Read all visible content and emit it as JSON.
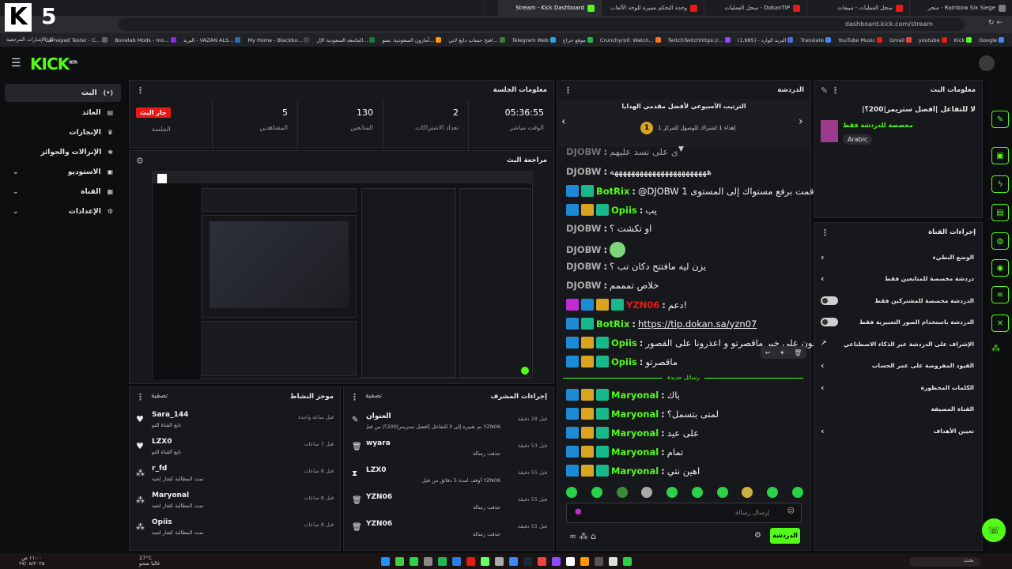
{
  "browser": {
    "tabs": [
      {
        "title": "Rainbow Six Siege - متجر",
        "color": "#7d7d7d"
      },
      {
        "title": "سجل العمليات - مبيعات",
        "color": "#e91916"
      },
      {
        "title": "DokanTIP - سجل العمليات",
        "color": "#e91916"
      },
      {
        "title": "وحدة التحكم مميزة للوحة الألعاب",
        "color": "#e91916"
      },
      {
        "title": "Stream - Kick Dashboard",
        "color": "#53fc18",
        "active": true
      },
      {
        "title": "+",
        "color": "#1b1d21"
      }
    ],
    "url": "dashboard.kick.com/stream",
    "bookmarks": [
      "Google",
      "Kick",
      "youtube",
      "Gmail",
      "YouTube Music",
      "Translate",
      "البريد الوارد - (1,985)",
      "TwitchTwitchhttps://...",
      "Crunchyroll: Watch...",
      "موقع حراج",
      "Telegram Web",
      "افتح حساب دايغ لاني...",
      "أمازون السعودية: تسو...",
      "الجامعة السعودية الإل...",
      "My Home - Blackbo...",
      "البريد - VAZAN ALS...",
      "Bonelab Mods - mo...",
      "Gamepad Tester - C..."
    ],
    "bookmarks_more": "كل الإشارات المرجعية"
  },
  "header": {
    "logo": "KICK",
    "beta": "BETA",
    "channel_digit": "5"
  },
  "sidebar": {
    "items": [
      {
        "label": "البث",
        "icon": "live-icon",
        "active": true
      },
      {
        "label": "العائد",
        "icon": "wallet-icon"
      },
      {
        "label": "الإنجازات",
        "icon": "trophy-icon"
      },
      {
        "label": "الإنزالات والجوائز",
        "icon": "gift-icon"
      },
      {
        "label": "الاستوديو",
        "icon": "studio-icon",
        "expand": true
      },
      {
        "label": "القناة",
        "icon": "channel-icon",
        "expand": true
      },
      {
        "label": "الإعدادات",
        "icon": "gear-icon",
        "expand": true
      }
    ]
  },
  "session": {
    "title": "معلومات الجلسة",
    "live_badge": "جار البث",
    "session_label": "الجلسة",
    "stats": [
      {
        "value": "05:36:55",
        "label": "الوقت مباشر"
      },
      {
        "value": "2",
        "label": "تعداد الاشتراكات"
      },
      {
        "value": "130",
        "label": "المتابعين"
      },
      {
        "value": "5",
        "label": "المشاهدين"
      }
    ]
  },
  "preview": {
    "title": "مراجعة البث"
  },
  "activity": {
    "title": "موجز النشاط",
    "filter": "تصفية",
    "items": [
      {
        "name": "Sara_144",
        "sub": "تابع القناة للتو",
        "time": "قبل ساعة واحدة"
      },
      {
        "name": "LZX0",
        "sub": "تابع القناة للتو",
        "time": "قبل 7 ساعات"
      },
      {
        "name": "r_fd",
        "sub": "تمت المطالبة كفتار لحيه",
        "time": "قبل 8 ساعات"
      },
      {
        "name": "Maryonal",
        "sub": "تمت المطالبة كفتار لحيه",
        "time": "قبل 8 ساعات"
      },
      {
        "name": "Opiis",
        "sub": "تمت المطالبة كفتار لحيه",
        "time": "قبل 8 ساعات"
      }
    ]
  },
  "modactions": {
    "title": "إجراءات المشرف",
    "filter": "تصفية",
    "items": [
      {
        "name": "العنوان",
        "sub": "YZN06 تم تغييره إلى لا للتفاعل |افضل ستريمر|200؟| من قبل",
        "time": "قبل 28 دقيقة"
      },
      {
        "name": "wyara",
        "sub": "حذفت رسالة",
        "time": "قبل 53 دقيقة"
      },
      {
        "name": "LZX0",
        "sub": "YZN06 أوقف لمدة 5 دقائق من قبل",
        "time": "قبل 55 دقيقة"
      },
      {
        "name": "YZN06",
        "sub": "حذفت رسالة",
        "time": "قبل 55 دقيقة"
      },
      {
        "name": "YZN06",
        "sub": "حذفت رسالة",
        "time": "قبل 55 دقيقة"
      }
    ]
  },
  "chat": {
    "title": "الدردشة",
    "leaderboard_title": "الترتيب الأسبوعي لأفضل مقدمي الهدايا",
    "leaderboard_sub": "إهداء 1 اشتراك للوصول للمركز 1",
    "rank": "1",
    "messages": [
      {
        "user": "DJOBW",
        "text": "ي على نسد عليهم",
        "color": "#aaaaaa"
      },
      {
        "user": "DJOBW",
        "text": "هههههههههههههههههههههههه",
        "color": "#aaaaaa"
      },
      {
        "user": "BotRix",
        "text": "@DJOBW قمت برفع مستواك إلى المستوى 1",
        "color": "#53fc18",
        "badges": [
          "blue",
          "teal"
        ]
      },
      {
        "user": "Opiis",
        "text": "يب",
        "color": "#53fc18",
        "badges": [
          "blue",
          "gold",
          "teal"
        ]
      },
      {
        "user": "DJOBW",
        "text": "او تكشت ؟",
        "color": "#aaaaaa"
      },
      {
        "user": "DJOBW",
        "text": "",
        "color": "#aaaaaa",
        "emote": true
      },
      {
        "user": "DJOBW",
        "text": "يزن ليه مافتتح دكان تب ؟",
        "color": "#aaaaaa"
      },
      {
        "user": "DJOBW",
        "text": "خلاص تمممم",
        "color": "#aaaaaa"
      },
      {
        "user": "YZN06",
        "text": "دعم!",
        "color": "#e91916",
        "badges": [
          "pink",
          "blue",
          "gold",
          "teal"
        ]
      },
      {
        "user": "BotRix",
        "text": "https://tip.dokan.sa/yzn07",
        "color": "#53fc18",
        "badges": [
          "blue",
          "teal"
        ]
      },
      {
        "user": "Opiis",
        "text": "تصبحون على خير ماقصرتو و اعذرونا على القصور",
        "color": "#53fc18",
        "badges": [
          "blue",
          "gold",
          "teal"
        ]
      },
      {
        "user": "Opiis",
        "text": "ماقصرتو",
        "color": "#53fc18",
        "badges": [
          "blue",
          "gold",
          "teal"
        ]
      }
    ],
    "new_messages": "رسائل جديدة",
    "new": [
      {
        "user": "Maryonal",
        "text": "باك"
      },
      {
        "user": "Maryonal",
        "text": "لمتى بتسمل؟"
      },
      {
        "user": "Maryonal",
        "text": "على عيد"
      },
      {
        "user": "Maryonal",
        "text": "تمام"
      },
      {
        "user": "Maryonal",
        "text": "اهين نتي"
      }
    ],
    "input_placeholder": "إرسال رسالة",
    "send": "الدردشة"
  },
  "streaminfo": {
    "title": "معلومات البث",
    "stream_title": "لا للتفاعل |افضل ستريمر|200؟|",
    "category": "مخصصة للدردشة فقط",
    "tag": "Arabic"
  },
  "channelactions": {
    "title": "إجراءات القناة",
    "items": [
      {
        "label": "الوضع البطيء",
        "type": "chevron"
      },
      {
        "label": "دردشة مخصصة للمتابعين فقط",
        "type": "chevron"
      },
      {
        "label": "الدردشة مخصصة للمشتركين فقط",
        "type": "toggle"
      },
      {
        "label": "الدردشة باستخدام الصور التعبيرية فقط",
        "type": "toggle"
      },
      {
        "label": "الإشراف على الدردشة عبر الذكاء الاصطناعي",
        "type": "link"
      },
      {
        "label": "القيود المفروضة على عمر الحساب",
        "type": "chevron"
      },
      {
        "label": "الكلمات المحظورة",
        "type": "chevron"
      },
      {
        "label": "القناة المضيفة",
        "type": "none"
      },
      {
        "label": "تعيين الأهداف",
        "type": "chevron"
      }
    ]
  },
  "taskbar": {
    "weather": "27°C",
    "weather_sub": "غالبا صحو",
    "time": "١١:٠٠ ص",
    "date": "٢٧/٠٥/٢٠٢٥",
    "search": "بحث"
  }
}
